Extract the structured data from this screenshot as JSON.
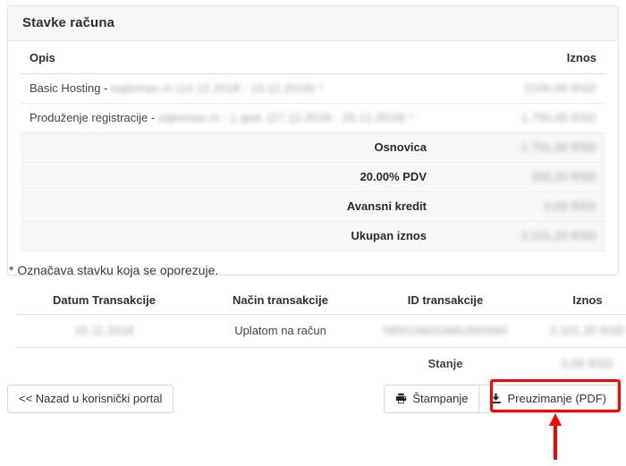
{
  "panel": {
    "title": "Stavke računa",
    "items_table": {
      "headers": [
        "Opis",
        "Iznos"
      ],
      "rows": [
        {
          "description_visible": "Basic Hosting - ",
          "description_redacted": "sajtomax.rs (14.12.2018 - 13.12.2019) *",
          "amount_redacted": "2100,00 RSD"
        },
        {
          "description_visible": "Produženje registracije - ",
          "description_redacted": "sajtomax.rs - 1 god. (27.12.2018 - 26.12.2019) *",
          "amount_redacted": "1.750,00 RSD"
        }
      ],
      "summary": [
        {
          "label": "Osnovica",
          "amount_redacted": "1.751,00 RSD"
        },
        {
          "label": "20.00% PDV",
          "amount_redacted": "350,20 RSD"
        },
        {
          "label": "Avansni kredit",
          "amount_redacted": "0,00 RSD"
        },
        {
          "label": "Ukupan iznos",
          "amount_redacted": "2.101,20 RSD"
        }
      ]
    }
  },
  "footnote": "* Označava stavku koja se oporezuje.",
  "transactions": {
    "headers": [
      "Datum Transakcije",
      "Način transakcije",
      "ID transakcije",
      "Iznos"
    ],
    "rows": [
      {
        "date_redacted": "15.11.2018",
        "method": "Uplatom na račun",
        "id_redacted": "5855168319MU000565",
        "amount_redacted": "2.101,20 RSD"
      }
    ],
    "balance_label": "Stanje",
    "balance_amount_redacted": "0,00 RSD"
  },
  "buttons": {
    "back": "<< Nazad u korisnički portal",
    "print": "Štampanje",
    "download": "Preuzimanje (PDF)"
  },
  "icons": {
    "print": "printer-icon",
    "download": "download-icon"
  },
  "annotation": {
    "highlight_color": "#ff0000",
    "target": "Preuzimanje (PDF)"
  }
}
